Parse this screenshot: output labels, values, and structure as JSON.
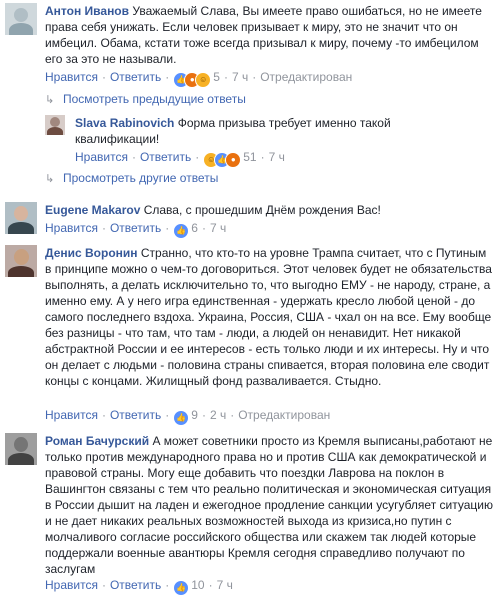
{
  "common": {
    "like": "Нравится",
    "reply": "Ответить",
    "dot": "·",
    "edited": "Отредактирован"
  },
  "comments": [
    {
      "author": "Антон Иванов",
      "text": "Уважаемый Слава, Вы имеете право ошибаться, но не имеете права себя унижать. Если человек призывает к миру, это не значит что он имбецил. Обама, кстати тоже всегда призывал к миру, почему -то имбецилом его за это не называли.",
      "reactions_count": "5",
      "time": "7 ч",
      "edited": true,
      "reactions": [
        "like-icon",
        "angry-icon",
        "haha-icon"
      ]
    },
    {
      "author": "Slava Rabinovich",
      "text": "Форма призыва требует именно такой квалификации!",
      "reactions_count": "51",
      "time": "7 ч",
      "edited": false,
      "reactions": [
        "haha-icon",
        "like-icon",
        "angry-icon"
      ]
    },
    {
      "author": "Eugene Makarov",
      "text": "Слава, с прошедшим Днём рождения Вас!",
      "reactions_count": "6",
      "time": "7 ч",
      "edited": false,
      "reactions": [
        "like-icon"
      ]
    },
    {
      "author": "Денис Воронин",
      "text": "Странно, что кто-то на уровне Трампа считает, что с Путиным в принципе можно о чем-то договориться. Этот человек будет не обязательства выполнять, а делать исключительно то, что выгодно ЕМУ - не народу, стране, а именно ему. А у него игра единственная - удержать кресло любой ценой - до самого последнего вздоха. Украина, Россия, США - чхал он на все. Ему вообще без разницы - что там, что там - люди, а людей он ненавидит. Нет никакой абстрактной России и ее интересов - есть только люди и их интересы. Ну и что он делает с людьми - половина страны спивается, вторая половина еле сводит концы с концами. Жилищный фонд разваливается. Стыдно.",
      "reactions_count": "9",
      "time": "2 ч",
      "edited": true,
      "reactions": [
        "like-icon"
      ]
    },
    {
      "author": "Роман Бачурский",
      "text": "А может советники просто из Кремля выписаны,работают не только против международного права но и против США как демократической и правовой страны. Могу еще добавить что поездки Лаврова на поклон в Вашингтон связаны с тем что реально политическая и экономическая ситуация в России дышит на ладен и ежегодное продление санкции усугубляет ситуацию и не дает никаких реальных возможностей выхода из кризиса,но путин с молчаливого согласие российского общества или скажем так людей которые поддержали военные авантюры Кремля сегодня справедливо получают по заслугам",
      "reactions_count": "10",
      "time": "7 ч",
      "edited": false,
      "reactions": [
        "like-icon"
      ]
    }
  ],
  "links": {
    "view_previous": "Посмотреть предыдущие ответы",
    "view_other": "Просмотреть другие ответы"
  }
}
